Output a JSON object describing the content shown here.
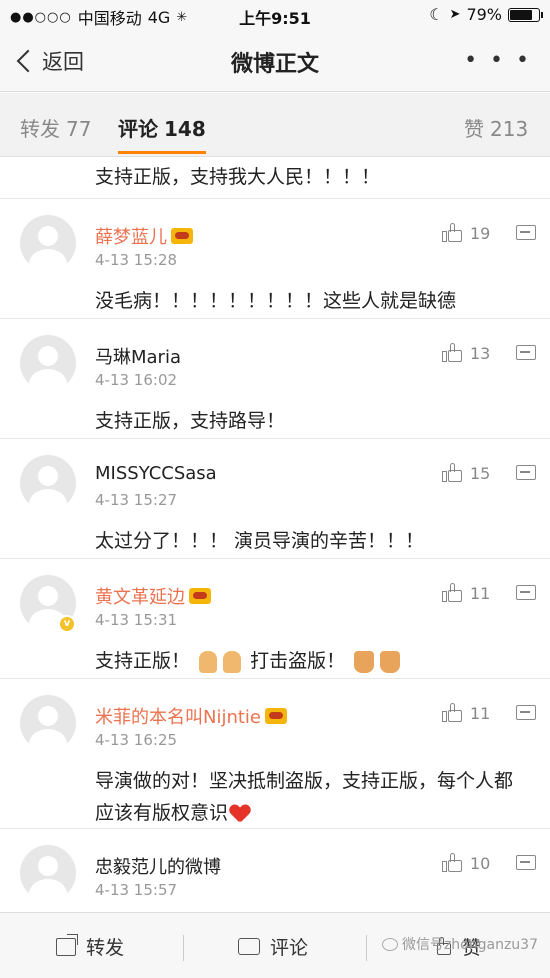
{
  "status_bar": {
    "signal": "●●○○○",
    "carrier": "中国移动",
    "network": "4G",
    "time": "上午9:51",
    "battery_percent": "79%",
    "battery_level": 0.79
  },
  "nav": {
    "back_label": "返回",
    "title": "微博正文",
    "more_label": "• • •"
  },
  "tabs": {
    "repost": {
      "label": "转发",
      "count": "77"
    },
    "comment": {
      "label": "评论",
      "count": "148"
    },
    "like": {
      "label": "赞",
      "count": "213"
    }
  },
  "partial_comment_text": "支持正版，支持我大人民！！！！",
  "comments": [
    {
      "user": "薛梦蓝儿",
      "time": "4-13 15:28",
      "text": "没毛病！！！！！！！！！这些人就是缺德",
      "likes": "19"
    },
    {
      "user": "马琳Maria",
      "time": "4-13 16:02",
      "text": "支持正版，支持路导！",
      "likes": "13"
    },
    {
      "user": "MISSYCCSasa",
      "time": "4-13 15:27",
      "text": "太过分了！！！ 演员导演的辛苦！！！",
      "likes": "15"
    },
    {
      "user": "黄文革延边",
      "time": "4-13 15:31",
      "text_a": "支持正版！",
      "text_b": "打击盗版！",
      "likes": "11"
    },
    {
      "user": "米菲的本名叫Nijntie",
      "time": "4-13 16:25",
      "text": "导演做的对！坚决抵制盗版，支持正版，每个人都应该有版权意识",
      "likes": "11"
    },
    {
      "user": "忠毅范儿的微博",
      "time": "4-13 15:57",
      "text": "",
      "likes": "10"
    }
  ],
  "toolbar": {
    "repost_label": "转发",
    "comment_label": "评论",
    "like_label": "赞"
  },
  "watermark": "微信号zhonganzu37",
  "colors": {
    "accent": "#ff8200",
    "vip_name": "#eb7350",
    "heart": "#e5332a"
  }
}
